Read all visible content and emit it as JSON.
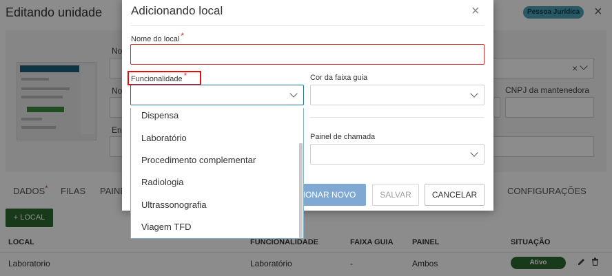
{
  "page": {
    "title": "Editando unidade",
    "badge": "Pessoa Jurídica",
    "close_symbol": "×"
  },
  "background_fields": {
    "name_label_partial": "No",
    "name2_label_partial": "No",
    "address_label_partial": "En",
    "cnpj_label": "CNPJ da mantenedora",
    "clear_symbol": "×"
  },
  "tabs": [
    {
      "label": "DADOS",
      "required": "*"
    },
    {
      "label": "FILAS"
    },
    {
      "label": "PAINE"
    },
    {
      "label": "CONFIGURAÇÕES"
    }
  ],
  "add_local_button": "LOCAL",
  "table": {
    "headers": {
      "local": "LOCAL",
      "funcionalidade": "FUNCIONALIDADE",
      "faixa": "FAIXA GUIA",
      "painel": "PAINEL",
      "situacao": "SITUAÇÃO"
    },
    "rows": [
      {
        "local": "Laboratorio",
        "funcionalidade": "Laboratório",
        "faixa": "-",
        "painel": "Ambos",
        "situacao": "Ativo"
      }
    ]
  },
  "modal": {
    "title": "Adicionando local",
    "close_symbol": "×",
    "nome_label": "Nome do local",
    "nome_value": "",
    "required_mark": "*",
    "funcionalidade_label": "Funcionalidade",
    "funcionalidade_value": "",
    "cor_label": "Cor da faixa guia",
    "cor_value": "",
    "painel_label": "Painel de chamada",
    "painel_value": "",
    "buttons": {
      "add_new": "IONAR NOVO",
      "save": "SALVAR",
      "cancel": "CANCELAR"
    }
  },
  "dropdown": {
    "options": [
      "Dispensa",
      "Laboratório",
      "Procedimento complementar",
      "Radiologia",
      "Ultrassonografia",
      "Viagem TFD"
    ]
  },
  "colors": {
    "primary_green": "#2e6b31",
    "accent_blue": "#1f6f8b",
    "required_red": "#d32f2f",
    "highlight_red": "#e01010",
    "badge_teal": "#4aa3b8",
    "add_new_button": "#7fa9d2"
  }
}
